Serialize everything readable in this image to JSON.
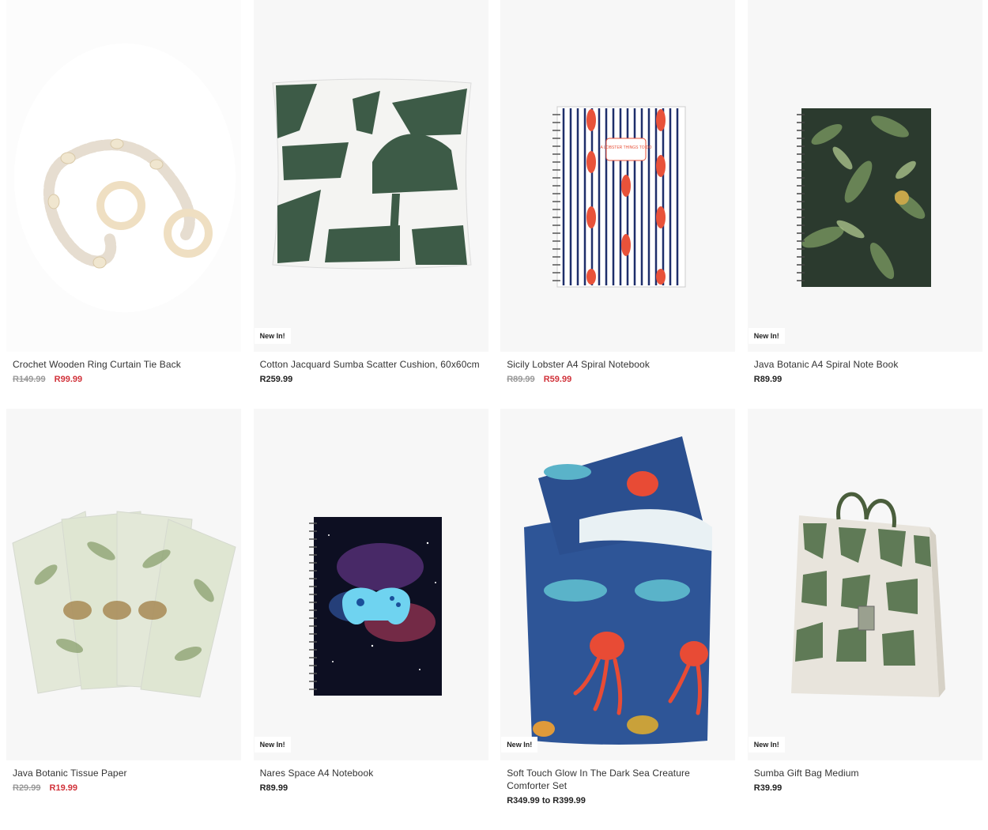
{
  "products": [
    {
      "name": "Crochet Wooden Ring Curtain Tie Back",
      "badge": "",
      "was": "R149.99",
      "price": "R99.99",
      "sale": true
    },
    {
      "name": "Cotton Jacquard Sumba Scatter Cushion, 60x60cm",
      "badge": "New In!",
      "was": "",
      "price": "R259.99",
      "sale": false
    },
    {
      "name": "Sicily Lobster A4 Spiral Notebook",
      "badge": "",
      "was": "R89.99",
      "price": "R59.99",
      "sale": true
    },
    {
      "name": "Java Botanic A4 Spiral Note Book",
      "badge": "New In!",
      "was": "",
      "price": "R89.99",
      "sale": false
    },
    {
      "name": "Java Botanic Tissue Paper",
      "badge": "",
      "was": "R29.99",
      "price": "R19.99",
      "sale": true
    },
    {
      "name": "Nares Space A4 Notebook",
      "badge": "New In!",
      "was": "",
      "price": "R89.99",
      "sale": false
    },
    {
      "name": "Soft Touch Glow In The Dark Sea Creature Comforter Set",
      "badge": "New In!",
      "was": "",
      "price": "R349.99 to R399.99",
      "sale": false
    },
    {
      "name": "Sumba Gift Bag Medium",
      "badge": "New In!",
      "was": "",
      "price": "R39.99",
      "sale": false
    }
  ],
  "notebook_cover_text": "A LOBSTER THINGS TO DO",
  "colors": {
    "sale": "#d1323a",
    "was": "#9a9a9a",
    "card_bg": "#f7f7f7",
    "sumba_green": "#3d5b47"
  }
}
